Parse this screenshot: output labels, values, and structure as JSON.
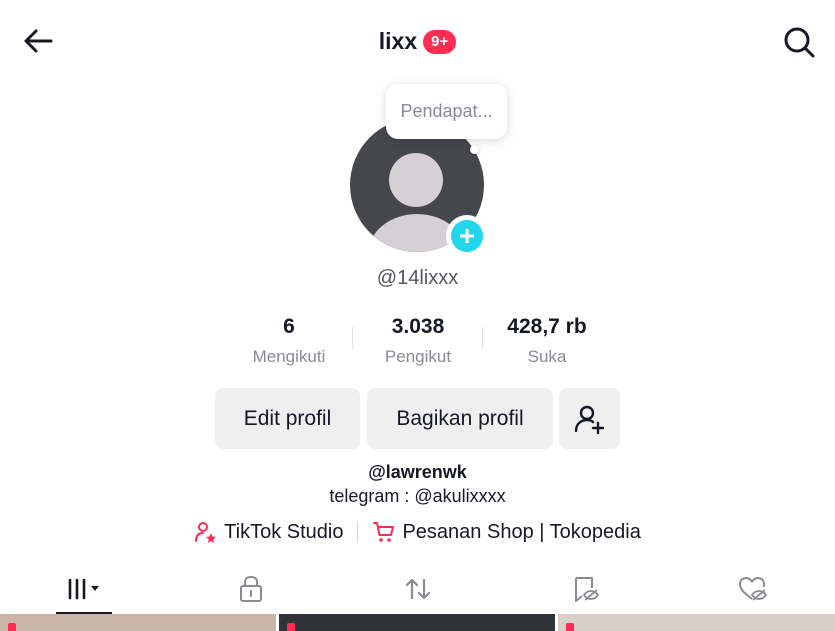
{
  "header": {
    "title": "lixx",
    "badge": "9+"
  },
  "note_bubble": {
    "text": "Pendapat..."
  },
  "profile": {
    "username": "@14lixxx"
  },
  "stats": [
    {
      "value": "6",
      "label": "Mengikuti"
    },
    {
      "value": "3.038",
      "label": "Pengikut"
    },
    {
      "value": "428,7 rb",
      "label": "Suka"
    }
  ],
  "actions": {
    "edit_label": "Edit profil",
    "share_label": "Bagikan profil"
  },
  "bio": {
    "mention": "@lawrenwk",
    "text": "telegram : @akulixxxx"
  },
  "links": {
    "studio": "TikTok Studio",
    "shop": "Pesanan Shop | Tokopedia"
  },
  "tabs": [
    {
      "name": "videos",
      "icon": "grid-icon"
    },
    {
      "name": "private",
      "icon": "lock-icon"
    },
    {
      "name": "reposts",
      "icon": "repost-icon"
    },
    {
      "name": "favorites",
      "icon": "bookmark-icon"
    },
    {
      "name": "liked",
      "icon": "heart-hidden-icon"
    }
  ],
  "colors": {
    "accent": "#fe2c55",
    "avatar_add": "#20d5ec"
  }
}
